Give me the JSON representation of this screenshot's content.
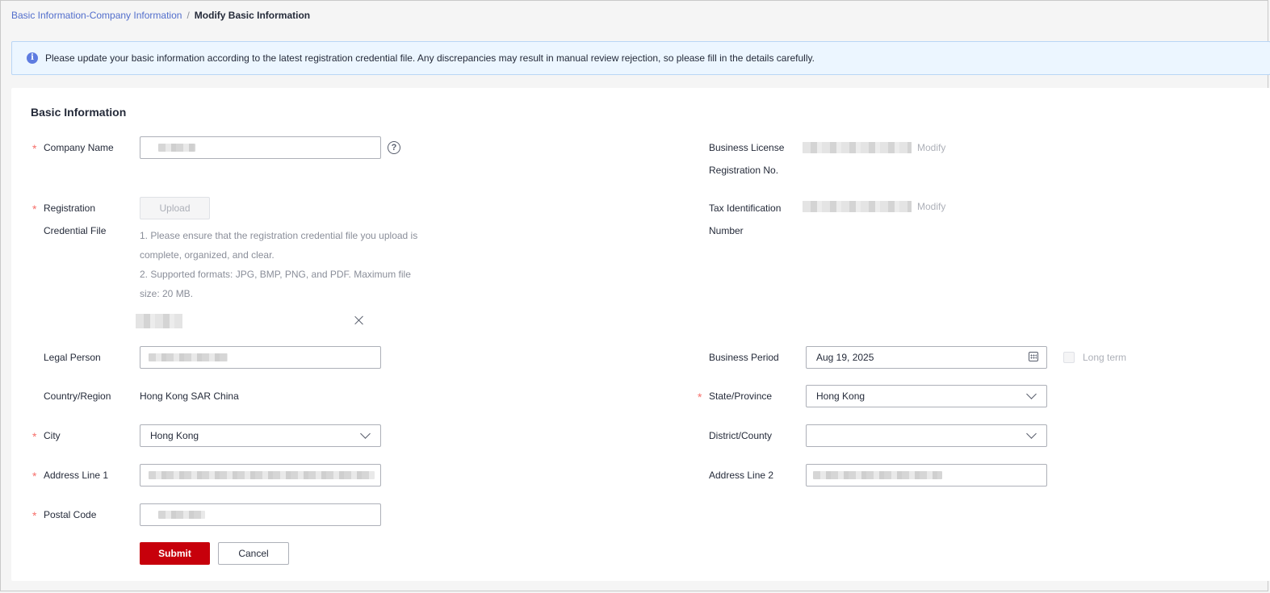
{
  "breadcrumb": {
    "parent": "Basic Information-Company Information",
    "separator": "/",
    "current": "Modify Basic Information"
  },
  "alert": {
    "icon": "info-icon",
    "text": "Please update your basic information according to the latest registration credential file. Any discrepancies may result in manual review rejection, so please fill in the details carefully."
  },
  "form": {
    "title": "Basic Information",
    "required_mark": "*",
    "company_name": {
      "label": "Company Name",
      "help": "?"
    },
    "registration": {
      "label_line1": "Registration",
      "label_line2": "Credential File",
      "upload_label": "Upload",
      "hint1_a": "1. Please ensure that the registration credential file you upload is",
      "hint1_b": "complete, organized, and clear.",
      "hint2_a": "2. Supported formats: JPG, BMP, PNG, and PDF. Maximum file",
      "hint2_b": "size: 20 MB."
    },
    "legal_person": {
      "label": "Legal Person"
    },
    "country": {
      "label": "Country/Region",
      "value": "Hong Kong SAR China"
    },
    "city": {
      "label": "City",
      "value": "Hong Kong"
    },
    "address1": {
      "label": "Address Line 1"
    },
    "postal_code": {
      "label": "Postal Code"
    },
    "business_license": {
      "label_line1": "Business License",
      "label_line2": "Registration No.",
      "modify": "Modify"
    },
    "tax_id": {
      "label_line1": "Tax Identification",
      "label_line2": "Number",
      "modify": "Modify"
    },
    "business_period": {
      "label": "Business Period",
      "value": "Aug 19, 2025",
      "long_term": "Long term"
    },
    "state": {
      "label": "State/Province",
      "value": "Hong Kong"
    },
    "district": {
      "label": "District/County",
      "value": ""
    },
    "address2": {
      "label": "Address Line 2"
    },
    "submit_label": "Submit",
    "cancel_label": "Cancel"
  },
  "colors": {
    "primary_button": "#c7000b",
    "link": "#526ecc",
    "required": "#f66f6a",
    "alert_bg": "#ecf6ff"
  }
}
